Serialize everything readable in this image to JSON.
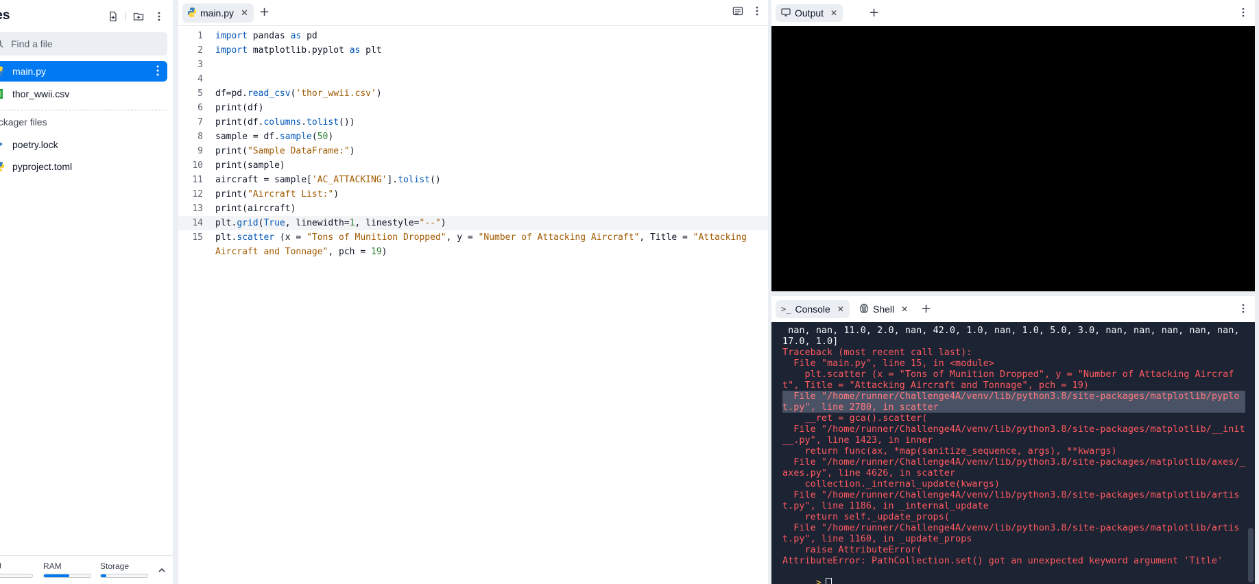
{
  "sidebar": {
    "title": "les",
    "search_placeholder": "Find a file",
    "files": [
      {
        "name": "main.py",
        "active": true
      },
      {
        "name": "thor_wwii.csv",
        "active": false
      }
    ],
    "packager_label": "ackager files",
    "packager_files": [
      {
        "name": "poetry.lock"
      },
      {
        "name": "pyproject.toml"
      }
    ],
    "resources": {
      "cpu_label": "J",
      "ram_label": "RAM",
      "storage_label": "Storage",
      "cpu_fraction": 0.0,
      "ram_fraction": 0.55,
      "storage_fraction": 0.12
    }
  },
  "editor": {
    "tab_label": "main.py",
    "lines": [
      {
        "n": "1",
        "code": "import pandas as pd"
      },
      {
        "n": "2",
        "code": "import matplotlib.pyplot as plt"
      },
      {
        "n": "3",
        "code": ""
      },
      {
        "n": "4",
        "code": ""
      },
      {
        "n": "5",
        "code": "df=pd.read_csv('thor_wwii.csv')"
      },
      {
        "n": "6",
        "code": "print(df)"
      },
      {
        "n": "7",
        "code": "print(df.columns.tolist())"
      },
      {
        "n": "8",
        "code": "sample = df.sample(50)"
      },
      {
        "n": "9",
        "code": "print(\"Sample DataFrame:\")"
      },
      {
        "n": "10",
        "code": "print(sample)"
      },
      {
        "n": "11",
        "code": "aircraft = sample['AC_ATTACKING'].tolist()"
      },
      {
        "n": "12",
        "code": "print(\"Aircraft List:\")"
      },
      {
        "n": "13",
        "code": "print(aircraft)"
      },
      {
        "n": "14",
        "code": "plt.grid(True, linewidth=1, linestyle=\"--\")"
      },
      {
        "n": "15",
        "code": "plt.scatter (x = \"Tons of Munition Dropped\", y = \"Number of Attacking Aircraft\", Title = \"Attacking Aircraft and Tonnage\", pch = 19)"
      }
    ]
  },
  "output": {
    "tab_label": "Output"
  },
  "console": {
    "tab_label": "Console",
    "shell_label": "Shell",
    "lines": [
      {
        "t": " nan, nan, 11.0, 2.0, nan, 42.0, 1.0, nan, 1.0, 5.0, 3.0, nan, nan, nan, nan, nan, 17.0, 1.0]",
        "k": "w"
      },
      {
        "t": "Traceback (most recent call last):",
        "k": "e"
      },
      {
        "t": "  File \"main.py\", line 15, in <module>",
        "k": "e"
      },
      {
        "t": "    plt.scatter (x = \"Tons of Munition Dropped\", y = \"Number of Attacking Aircraft\", Title = \"Attacking Aircraft and Tonnage\", pch = 19)",
        "k": "e"
      },
      {
        "t": "  File \"/home/runner/Challenge4A/venv/lib/python3.8/site-packages/matplotlib/pyplot.py\", line 2780, in scatter",
        "k": "hl"
      },
      {
        "t": "    __ret = gca().scatter(",
        "k": "e"
      },
      {
        "t": "  File \"/home/runner/Challenge4A/venv/lib/python3.8/site-packages/matplotlib/__init__.py\", line 1423, in inner",
        "k": "e"
      },
      {
        "t": "    return func(ax, *map(sanitize_sequence, args), **kwargs)",
        "k": "e"
      },
      {
        "t": "  File \"/home/runner/Challenge4A/venv/lib/python3.8/site-packages/matplotlib/axes/_axes.py\", line 4626, in scatter",
        "k": "e"
      },
      {
        "t": "    collection._internal_update(kwargs)",
        "k": "e"
      },
      {
        "t": "  File \"/home/runner/Challenge4A/venv/lib/python3.8/site-packages/matplotlib/artist.py\", line 1186, in _internal_update",
        "k": "e"
      },
      {
        "t": "    return self._update_props(",
        "k": "e"
      },
      {
        "t": "  File \"/home/runner/Challenge4A/venv/lib/python3.8/site-packages/matplotlib/artist.py\", line 1160, in _update_props",
        "k": "e"
      },
      {
        "t": "    raise AttributeError(",
        "k": "e"
      },
      {
        "t": "AttributeError: PathCollection.set() got an unexpected keyword argument 'Title'",
        "k": "e"
      }
    ],
    "prompt_symbol": ">"
  },
  "colors": {
    "accent": "#0079f2",
    "console_bg": "#1c2333",
    "error": "#ff5a5f",
    "prompt": "#f5c542"
  }
}
